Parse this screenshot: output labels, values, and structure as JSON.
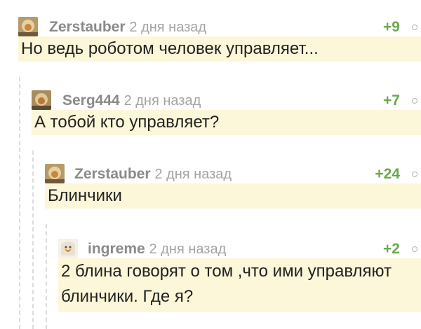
{
  "comments": [
    {
      "username": "Zerstauber",
      "timestamp": "2 дня назад",
      "rating": "+9",
      "avatar_icon": "user-avatar-icon",
      "text": "Но ведь роботом человек управляет..."
    },
    {
      "username": "Serg444",
      "timestamp": "2 дня назад",
      "rating": "+7",
      "avatar_icon": "user-avatar-icon",
      "text": "А тобой кто управляет?"
    },
    {
      "username": "Zerstauber",
      "timestamp": "2 дня назад",
      "rating": "+24",
      "avatar_icon": "user-avatar-icon",
      "text": "Блинчики"
    },
    {
      "username": "ingreme",
      "timestamp": "2 дня назад",
      "rating": "+2",
      "avatar_icon": "user-avatar-icon",
      "text": "2 блина говорят о том ,что ими управляют блинчики. Где я?"
    }
  ],
  "colors": {
    "comment_bg": "#fcf7d9",
    "rating_positive": "#69a84a",
    "username": "#8a8a8a",
    "timestamp": "#a4a4a4"
  }
}
